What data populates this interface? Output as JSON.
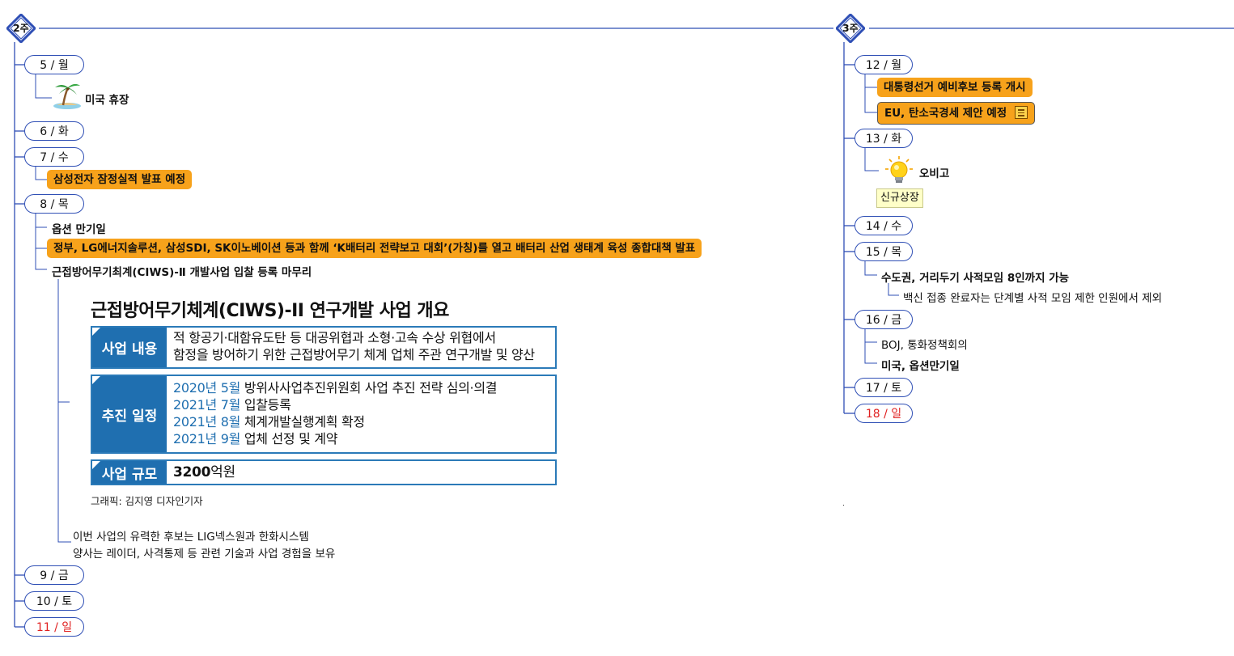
{
  "weeks": [
    {
      "label": "2주",
      "days": [
        {
          "label": "5 / 월"
        },
        {
          "label": "6 / 화"
        },
        {
          "label": "7 / 수"
        },
        {
          "label": "8 / 목"
        },
        {
          "label": "9 / 금"
        },
        {
          "label": "10 / 토"
        },
        {
          "label": "11 / 일"
        }
      ]
    },
    {
      "label": "3주",
      "days": [
        {
          "label": "12 / 월"
        },
        {
          "label": "13 / 화"
        },
        {
          "label": "14 / 수"
        },
        {
          "label": "15 / 목"
        },
        {
          "label": "16 / 금"
        },
        {
          "label": "17 / 토"
        },
        {
          "label": "18 / 일"
        }
      ]
    }
  ],
  "events": {
    "d5": {
      "icon": "palm-tree-icon",
      "text": "미국 휴장"
    },
    "d7": {
      "text": "삼성전자 잠정실적 발표 예정"
    },
    "d8": {
      "items": [
        "옵션 만기일",
        "정부, LG에너지솔루션, 삼성SDI, SK이노베이션 등과 함께 ‘K배터리 전략보고 대회’(가칭)를 열고 배터리 산업 생태계 육성 종합대책 발표",
        "근접방어무기최계(CIWS)-Ⅱ 개발사업 입찰 등록 마무리"
      ],
      "note_line1": "이번 사업의 유력한 후보는 LIG넥스원과 한화시스템",
      "note_line2": "양사는 레이더, 사격통제 등 관련 기술과 사업 경험을 보유"
    },
    "d12": {
      "items": [
        "대통령선거 예비후보 등록 개시",
        "EU, 탄소국경세 제안 예정"
      ],
      "note_icon": "note-icon"
    },
    "d13": {
      "icon": "lightbulb-icon",
      "text": "오비고",
      "tag": "신규상장"
    },
    "d15": {
      "text": "수도권, 거리두기 사적모임 8인까지 가능",
      "sub": "백신 접종 완료자는 단계별 사적 모임 제한 인원에서 제외"
    },
    "d16": {
      "items": [
        "BOJ, 통화정책회의",
        "미국, 옵션만기일"
      ]
    }
  },
  "infographic": {
    "title": "근접방어무기체계(CIWS)-II 연구개발 사업 개요",
    "rows": [
      {
        "head": "사업 내용",
        "lines": [
          "적 항공기·대함유도탄 등 대공위협과 소형·고속 수상 위협에서",
          "함정을 방어하기 위한 근접방어무기 체계 업체 주관 연구개발 및 양산"
        ]
      },
      {
        "head": "추진 일정",
        "schedule": [
          {
            "year": "2020년 5월",
            "text": "방위사사업추진위원회 사업 추진 전략 심의·의결"
          },
          {
            "year": "2021년 7월",
            "text": "입찰등록"
          },
          {
            "year": "2021년 8월",
            "text": "체계개발실행계획 확정"
          },
          {
            "year": "2021년 9월",
            "text": "업체 선정 및 계약"
          }
        ]
      },
      {
        "head": "사업 규모",
        "value_bold": "3200",
        "value_rest": "억원"
      }
    ],
    "credit": "그래픽: 김지영 디자인기자"
  },
  "colors": {
    "line": "#2f4fb5",
    "highlight": "#f7a21b",
    "sunday": "#e02020",
    "infographic_blue": "#1f6fb0"
  }
}
